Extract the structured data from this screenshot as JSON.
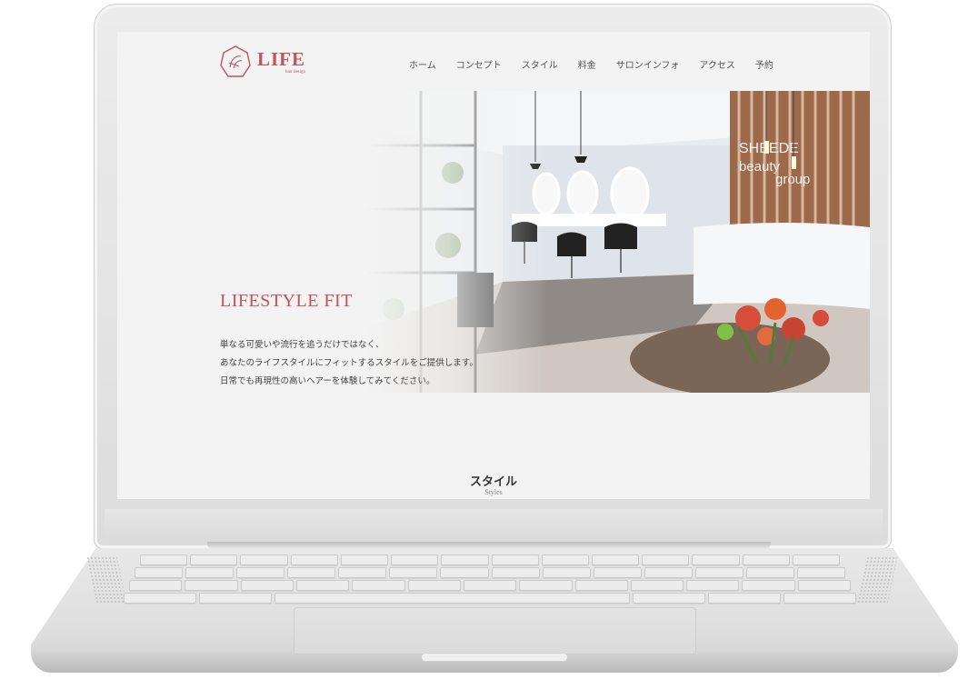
{
  "site": {
    "logo_text": "LIFE",
    "logo_subtext": "hair design",
    "nav": [
      "ホーム",
      "コンセプト",
      "スタイル",
      "料金",
      "サロンインフォ",
      "アクセス",
      "予約"
    ]
  },
  "hero": {
    "title": "LIFESTYLE FIT",
    "lines": [
      "単なる可愛いや流行を追うだけではなく、",
      "あなたのライフスタイルにフィットするスタイルをご提供します。",
      "日常でも再現性の高いヘアーを体験してみてください。"
    ],
    "photo_sign": [
      "SHEEDE",
      "beauty",
      "group"
    ]
  },
  "section": {
    "title": "スタイル",
    "subtitle": "Styles"
  },
  "colors": {
    "brand": "#c0545a",
    "screen_bg": "#f3f3f3"
  }
}
